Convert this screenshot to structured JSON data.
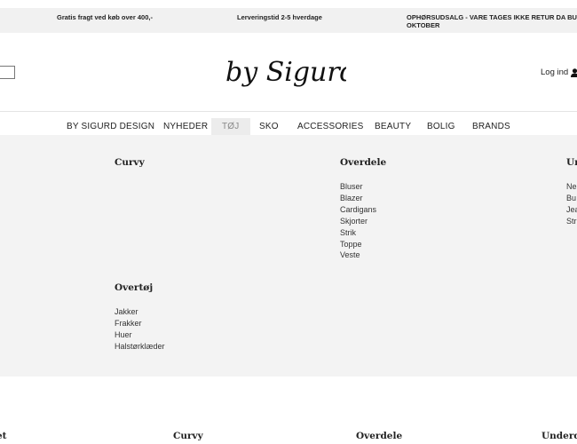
{
  "topbar": {
    "shipping": "Gratis fragt ved køb over 400,-",
    "delivery": "Lerveringstid 2-5 hverdage",
    "sale_line1": "OPHØRSUDSALG - VARE TAGES IKKE RETUR DA BUTIKKEN",
    "sale_line2": "OKTOBER"
  },
  "header": {
    "logo_text": "by Sigurd",
    "login_label": "Log ind",
    "login_icon": "user-icon"
  },
  "nav": {
    "items": [
      "BY SIGURD DESIGN",
      "NYHEDER",
      "TØJ",
      "SKO",
      "ACCESSORIES",
      "BEAUTY",
      "BOLIG",
      "BRANDS"
    ],
    "active": "TØJ"
  },
  "mega": {
    "curvy": {
      "title": "Curvy"
    },
    "overdele": {
      "title": "Overdele",
      "links": [
        "Bluser",
        "Blazer",
        "Cardigans",
        "Skjorter",
        "Strik",
        "Toppe",
        "Veste"
      ]
    },
    "underdele": {
      "title": "Un",
      "links": [
        "Ne",
        "Bu",
        "Jea",
        "Str"
      ]
    },
    "overtoj": {
      "title": "Overtøj",
      "links": [
        "Jakker",
        "Frakker",
        "Huer",
        "Halstørklæder"
      ]
    }
  },
  "bottom": {
    "titles": [
      "et",
      "Curvy",
      "Overdele",
      "Underde"
    ]
  }
}
